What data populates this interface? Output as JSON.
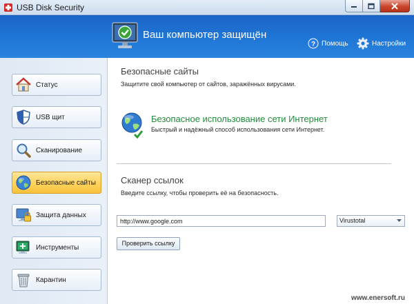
{
  "window": {
    "title": "USB Disk Security"
  },
  "header": {
    "status_title": "Ваш компьютер защищён",
    "help_label": "Помощь",
    "settings_label": "Настройки"
  },
  "sidebar": {
    "items": [
      {
        "label": "Статус",
        "icon": "home-icon",
        "active": false
      },
      {
        "label": "USB щит",
        "icon": "shield-icon",
        "active": false
      },
      {
        "label": "Сканирование",
        "icon": "magnifier-icon",
        "active": false
      },
      {
        "label": "Безопасные сайты",
        "icon": "globe-icon",
        "active": true
      },
      {
        "label": "Защита данных",
        "icon": "monitor-lock-icon",
        "active": false
      },
      {
        "label": "Инструменты",
        "icon": "tools-monitor-icon",
        "active": false
      },
      {
        "label": "Карантин",
        "icon": "trash-bin-icon",
        "active": false
      }
    ]
  },
  "safe_sites": {
    "title": "Безопасные сайты",
    "description": "Защитите свой компьютер от сайтов, заражённых вирусами.",
    "feature_title": "Безопасное использование сети Интернет",
    "feature_description": "Быстрый и надёжный способ использования сети Интернет."
  },
  "link_scanner": {
    "title": "Сканер ссылок",
    "description": "Введите ссылку, чтобы проверить её на безопасность.",
    "url_value": "http://www.google.com",
    "service_selected": "Virustotal",
    "check_button": "Проверить ссылку"
  },
  "watermark": "www.enersoft.ru",
  "colors": {
    "header_blue": "#1f76d6",
    "active_nav": "#ffd35c",
    "feature_green": "#1f8c3a"
  }
}
